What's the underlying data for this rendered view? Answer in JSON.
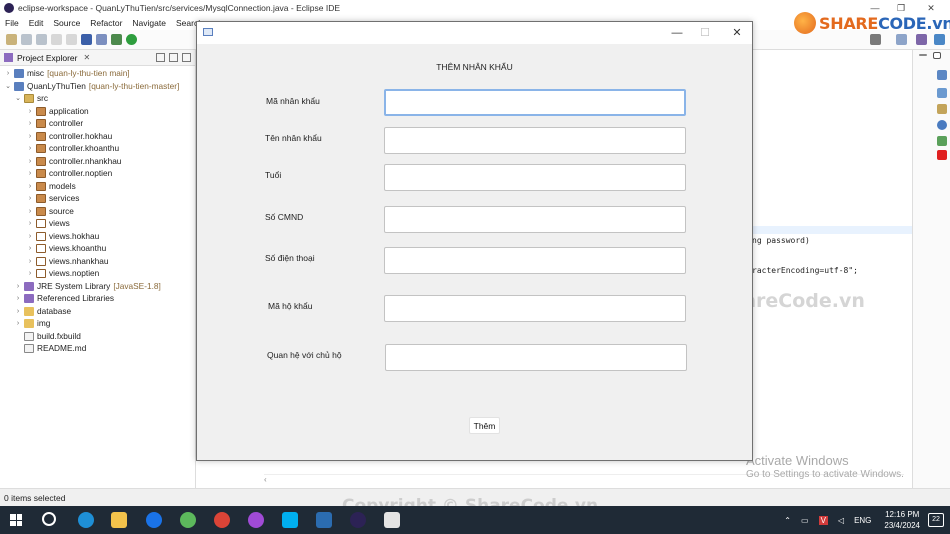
{
  "window": {
    "title": "eclipse-workspace - QuanLyThuTien/src/services/MysqlConnection.java - Eclipse IDE",
    "minimize": "—",
    "restore": "❐",
    "close": "✕"
  },
  "menubar": [
    "File",
    "Edit",
    "Source",
    "Refactor",
    "Navigate",
    "Search"
  ],
  "explorer": {
    "tab_label": "Project Explorer",
    "close": "✕",
    "tree": [
      {
        "label": "misc",
        "decor": "[quan-ly-thu-tien main]",
        "icon": "project-icon"
      },
      {
        "label": "QuanLyThuTien",
        "decor": "[quan-ly-thu-tien-master]",
        "icon": "project-icon"
      },
      {
        "label": "src",
        "icon": "source-folder-icon"
      },
      {
        "label": "application",
        "icon": "package-icon"
      },
      {
        "label": "controller",
        "icon": "package-icon"
      },
      {
        "label": "controller.hokhau",
        "icon": "package-icon"
      },
      {
        "label": "controller.khoanthu",
        "icon": "package-icon"
      },
      {
        "label": "controller.nhankhau",
        "icon": "package-icon"
      },
      {
        "label": "controller.noptien",
        "icon": "package-icon"
      },
      {
        "label": "models",
        "icon": "package-icon"
      },
      {
        "label": "services",
        "icon": "package-icon"
      },
      {
        "label": "source",
        "icon": "package-icon"
      },
      {
        "label": "views",
        "icon": "package-icon"
      },
      {
        "label": "views.hokhau",
        "icon": "package-icon"
      },
      {
        "label": "views.khoanthu",
        "icon": "package-icon"
      },
      {
        "label": "views.nhankhau",
        "icon": "package-icon"
      },
      {
        "label": "views.noptien",
        "icon": "package-icon"
      },
      {
        "label": "JRE System Library",
        "decor": "[JavaSE-1.8]",
        "icon": "library-icon"
      },
      {
        "label": "Referenced Libraries",
        "icon": "library-icon"
      },
      {
        "label": "database",
        "icon": "folder-icon"
      },
      {
        "label": "img",
        "icon": "folder-icon"
      },
      {
        "label": "build.fxbuild",
        "icon": "file-icon"
      },
      {
        "label": "README.md",
        "icon": "file-icon"
      }
    ]
  },
  "editor": {
    "visible_code": [
      "ng password)",
      "racterEncoding=utf-8\";"
    ]
  },
  "status": {
    "text": "0 items selected"
  },
  "watermarks": {
    "logo_share": "SHARE",
    "logo_code": "CODE.vn",
    "mid": "ShareCode.vn",
    "copyright": "Copyright © ShareCode.vn",
    "activate_title": "Activate Windows",
    "activate_sub": "Go to Settings to activate Windows."
  },
  "dialog": {
    "minimize": "—",
    "maximize": "☐",
    "close": "✕",
    "heading": "THÊM NHÂN KHẨU",
    "fields": [
      {
        "label": "Mã nhân khẩu",
        "value": ""
      },
      {
        "label": "Tên nhân khẩu",
        "value": ""
      },
      {
        "label": "Tuổi",
        "value": ""
      },
      {
        "label": "Số CMND",
        "value": ""
      },
      {
        "label": "Số điện thoại",
        "value": ""
      },
      {
        "label": "Mã hộ khẩu",
        "value": ""
      },
      {
        "label": "Quan hệ với chủ hộ",
        "value": ""
      }
    ],
    "submit_label": "Thêm"
  },
  "taskbar": {
    "tray_language": "ENG",
    "clock_time": "12:16 PM",
    "clock_date": "23/4/2024",
    "notifications": "22"
  }
}
